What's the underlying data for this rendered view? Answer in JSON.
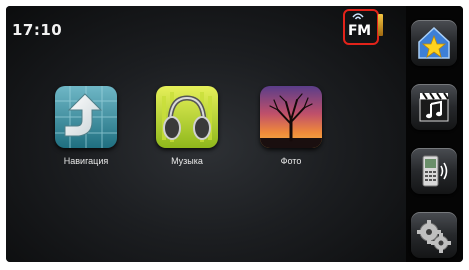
{
  "status_bar": {
    "time": "17:10",
    "radio_indicator": {
      "label": "FM",
      "icon": "fm-radio-icon",
      "highlight_color": "#e2231a"
    }
  },
  "apps": [
    {
      "label": "Навигация",
      "icon": "navigation-arrow-icon"
    },
    {
      "label": "Музыка",
      "icon": "headphones-icon"
    },
    {
      "label": "Фото",
      "icon": "photo-tree-icon"
    }
  ],
  "sidebar": [
    {
      "icon": "favorites-star-icon"
    },
    {
      "icon": "media-clapper-note-icon"
    },
    {
      "icon": "phone-bluetooth-icon"
    },
    {
      "icon": "settings-gears-icon"
    }
  ]
}
